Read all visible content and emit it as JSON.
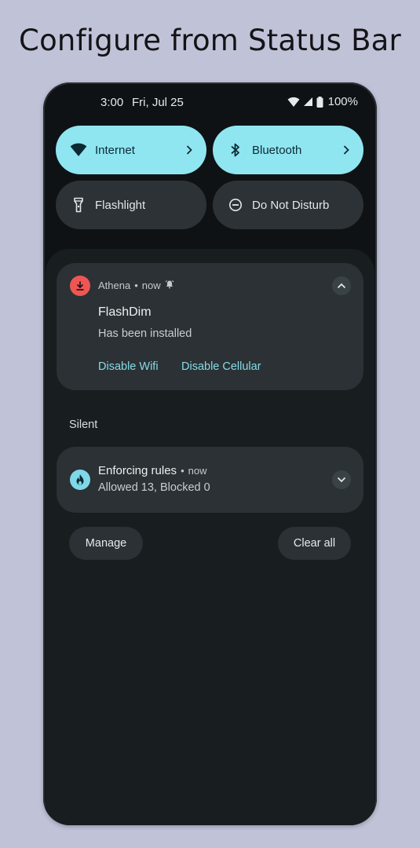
{
  "headline": "Configure from Status Bar",
  "status_bar": {
    "time": "3:00",
    "date": "Fri, Jul 25",
    "battery": "100%"
  },
  "quick_tiles": [
    {
      "label": "Internet",
      "state": "on",
      "icon": "wifi-icon"
    },
    {
      "label": "Bluetooth",
      "state": "on",
      "icon": "bluetooth-icon"
    },
    {
      "label": "Flashlight",
      "state": "off",
      "icon": "flashlight-icon"
    },
    {
      "label": "Do Not Disturb",
      "state": "off",
      "icon": "do-not-disturb-icon"
    }
  ],
  "notifications": {
    "athena": {
      "app": "Athena",
      "separator": "•",
      "time": "now",
      "title": "FlashDim",
      "body": "Has been installed",
      "actions": [
        "Disable Wifi",
        "Disable Cellular"
      ],
      "icon": "download-icon"
    },
    "section_label": "Silent",
    "rules": {
      "title": "Enforcing rules",
      "separator": "•",
      "time": "now",
      "body": "Allowed 13, Blocked 0",
      "icon": "flame-icon"
    }
  },
  "buttons": {
    "manage": "Manage",
    "clear_all": "Clear all"
  },
  "colors": {
    "background": "#c0c3d8",
    "tile_on": "#8fe6f1",
    "tile_off": "#2c3235",
    "accent_action": "#86dbe8",
    "athena_badge": "#ee5656"
  }
}
